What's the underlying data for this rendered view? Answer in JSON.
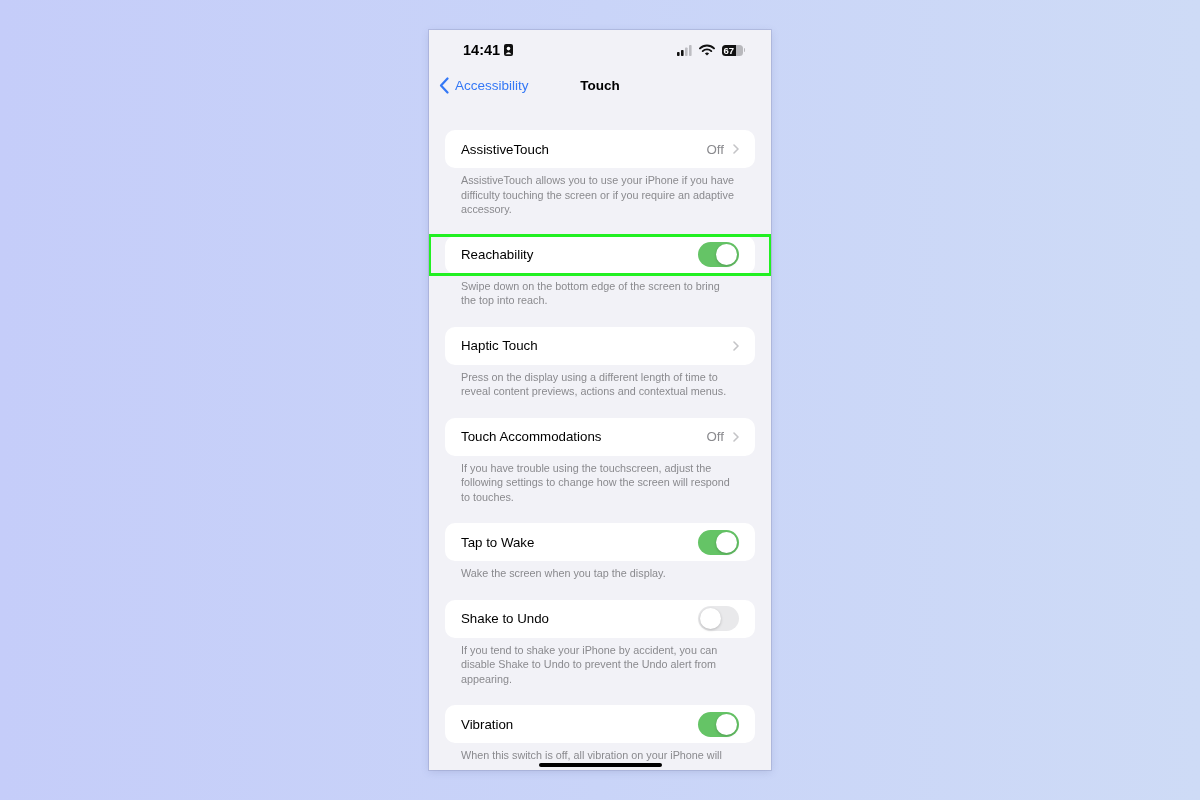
{
  "status_bar": {
    "time": "14:41",
    "battery": "67"
  },
  "nav": {
    "back": "Accessibility",
    "title": "Touch"
  },
  "groups": [
    {
      "kind": "link",
      "label": "AssistiveTouch",
      "value": "Off",
      "highlighted": false,
      "footer": "AssistiveTouch allows you to use your iPhone if you have difficulty touching the screen or if you require an adaptive accessory."
    },
    {
      "kind": "switch",
      "label": "Reachability",
      "on": true,
      "highlighted": true,
      "footer": "Swipe down on the bottom edge of the screen to bring the top into reach."
    },
    {
      "kind": "link",
      "label": "Haptic Touch",
      "highlighted": false,
      "footer": "Press on the display using a different length of time to reveal content previews, actions and contextual menus."
    },
    {
      "kind": "link",
      "label": "Touch Accommodations",
      "value": "Off",
      "highlighted": false,
      "footer": "If you have trouble using the touchscreen, adjust the following settings to change how the screen will respond to touches."
    },
    {
      "kind": "switch",
      "label": "Tap to Wake",
      "on": true,
      "highlighted": false,
      "footer": "Wake the screen when you tap the display."
    },
    {
      "kind": "switch",
      "label": "Shake to Undo",
      "on": false,
      "highlighted": false,
      "footer": "If you tend to shake your iPhone by accident, you can disable Shake to Undo to prevent the Undo alert from appearing."
    },
    {
      "kind": "switch",
      "label": "Vibration",
      "on": true,
      "highlighted": false,
      "footer": "When this switch is off, all vibration on your iPhone will"
    }
  ]
}
